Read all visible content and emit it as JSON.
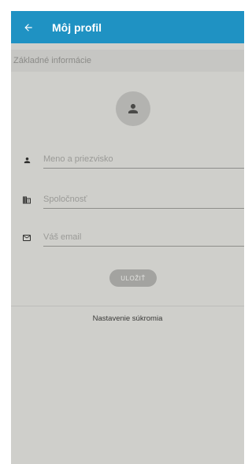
{
  "appbar": {
    "title": "Môj profil",
    "back_icon": "arrow-left-icon",
    "color": "#1f92c3"
  },
  "section": {
    "title": "Základné informácie"
  },
  "avatar": {
    "icon": "person-icon"
  },
  "form": {
    "name": {
      "placeholder": "Meno a priezvisko",
      "value": "",
      "icon": "person-icon"
    },
    "company": {
      "placeholder": "Spoločnosť",
      "value": "",
      "icon": "building-icon"
    },
    "email": {
      "placeholder": "Váš email",
      "value": "",
      "icon": "mail-icon"
    },
    "save_label": "ULOŽIŤ"
  },
  "footer": {
    "privacy_label": "Nastavenie súkromia"
  }
}
